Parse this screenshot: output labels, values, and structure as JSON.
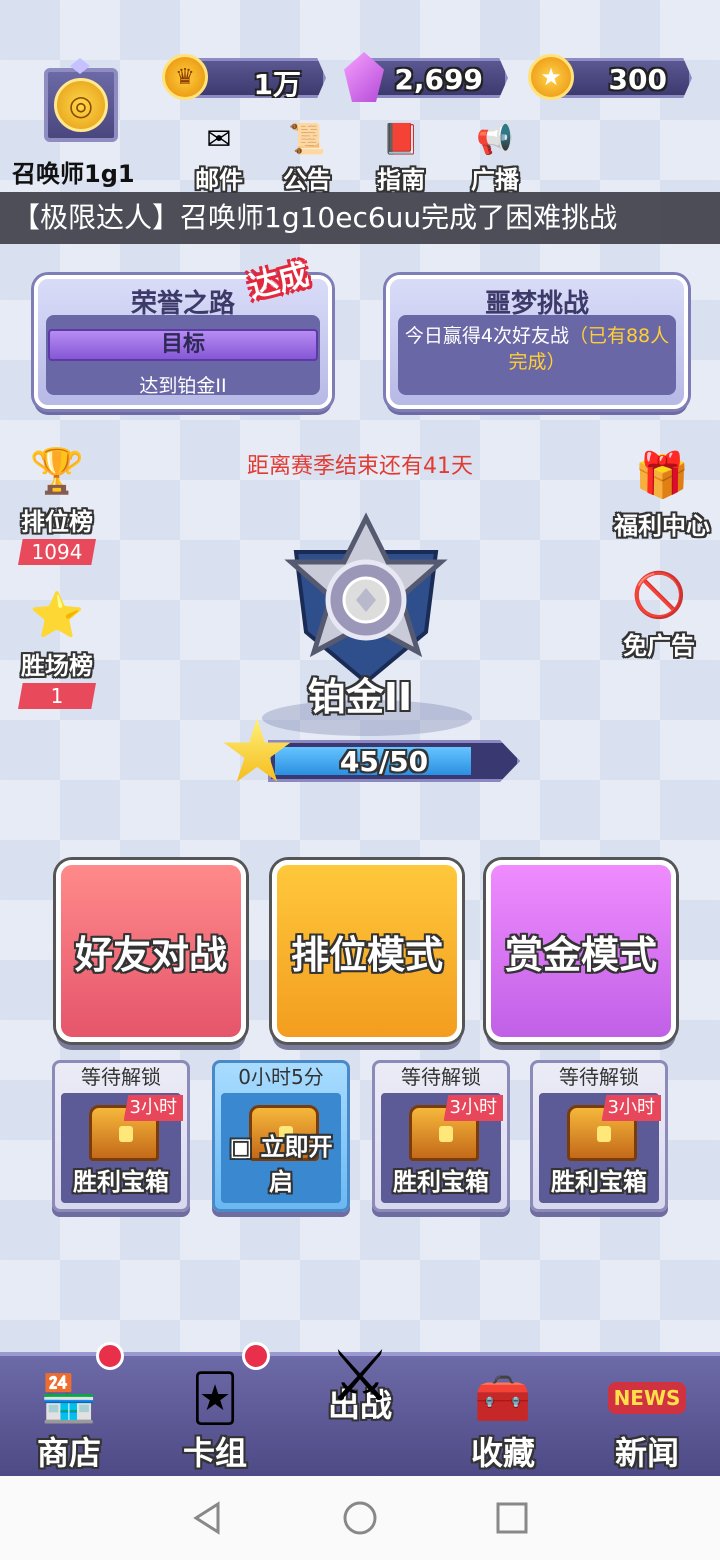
{
  "player": {
    "name": "召唤师1g1"
  },
  "currencies": {
    "gold": "1万",
    "gems": "2,699",
    "badges": "300"
  },
  "toolbar": {
    "mail": "邮件",
    "notice": "公告",
    "guide": "指南",
    "broadcast": "广播"
  },
  "ticker": "【极限达人】召唤师1g10ec6uu完成了困难挑战",
  "honor_panel": {
    "title": "荣誉之路",
    "badge": "达成",
    "goal_label": "目标",
    "goal_text": "达到铂金II"
  },
  "nightmare_panel": {
    "title": "噩梦挑战",
    "desc": "今日赢得4次好友战",
    "highlight": "（已有88人完成）"
  },
  "season_text": "距离赛季结束还有41天",
  "left_side": [
    {
      "label": "排位榜",
      "count": "1094"
    },
    {
      "label": "胜场榜",
      "count": "1"
    }
  ],
  "right_side": [
    {
      "label": "福利中心"
    },
    {
      "label": "免广告"
    }
  ],
  "rank": {
    "name": "铂金II",
    "xp_text": "45/50",
    "xp_fraction": 0.9
  },
  "modes": {
    "friend": "好友对战",
    "ranked": "排位模式",
    "bounty": "赏金模式"
  },
  "chests": [
    {
      "top": "等待解锁",
      "timer": "3小时",
      "label": "胜利宝箱",
      "active": false
    },
    {
      "top": "0小时5分",
      "timer": "",
      "label": "立即开启",
      "active": true
    },
    {
      "top": "等待解锁",
      "timer": "3小时",
      "label": "胜利宝箱",
      "active": false
    },
    {
      "top": "等待解锁",
      "timer": "3小时",
      "label": "胜利宝箱",
      "active": false
    }
  ],
  "nav": {
    "shop": "商店",
    "deck": "卡组",
    "battle": "出战",
    "collection": "收藏",
    "news": "新闻",
    "news_icon_text": "NEWS"
  },
  "colors": {
    "accent_red": "#e8304a",
    "purple": "#6a67a6",
    "blue": "#2a8fe0"
  }
}
